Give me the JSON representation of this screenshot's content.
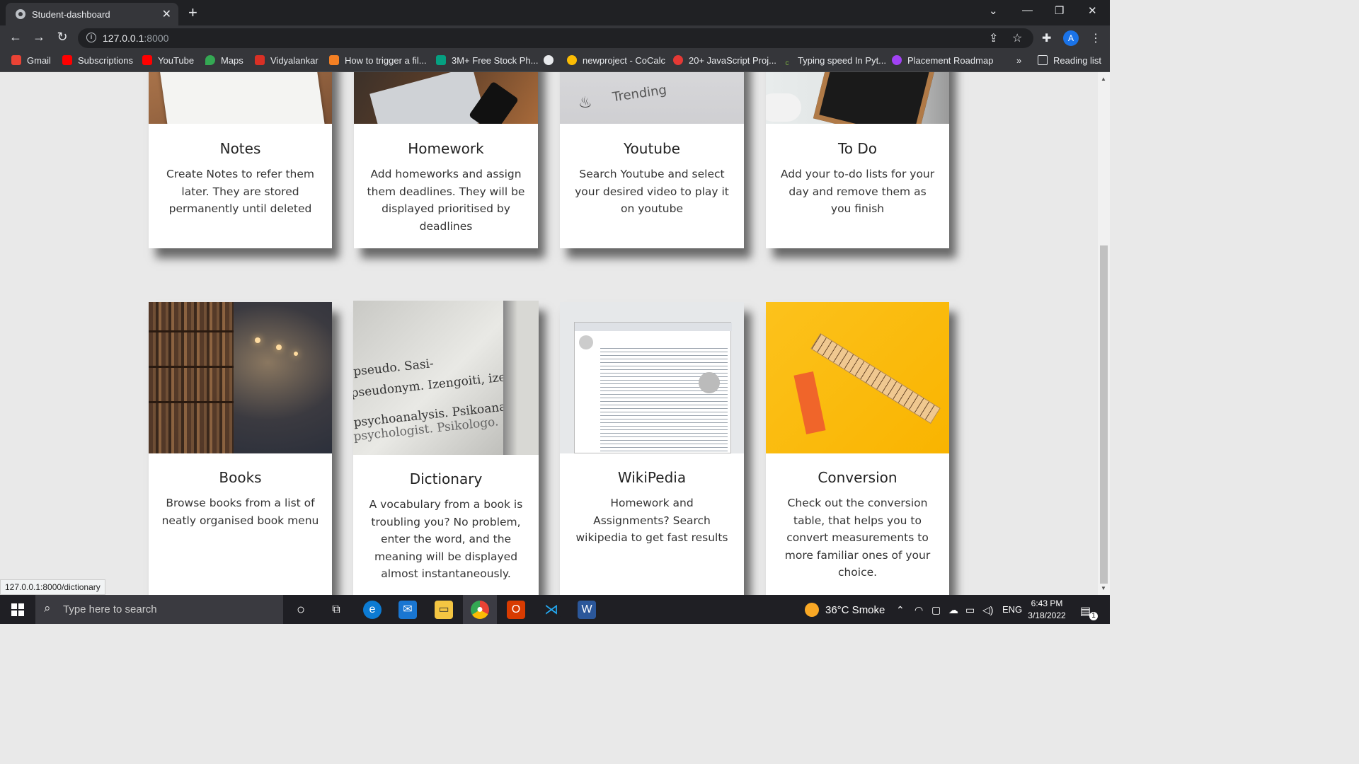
{
  "browser": {
    "tab_title": "Student-dashboard",
    "url_host": "127.0.0.1",
    "url_port": ":8000",
    "profile_initial": "A",
    "bookmarks": [
      "Gmail",
      "Subscriptions",
      "YouTube",
      "Maps",
      "Vidyalankar",
      "How to trigger a fil...",
      "3M+ Free Stock Ph...",
      "newproject - CoCalc",
      "20+ JavaScript Proj...",
      "Typing speed In Pyt...",
      "Placement Roadmap"
    ],
    "overflow": "»",
    "reading_list": "Reading list"
  },
  "cards_top": [
    {
      "title": "Notes",
      "desc": "Create Notes to refer them later. They are stored permanently until deleted"
    },
    {
      "title": "Homework",
      "desc": "Add homeworks and assign them deadlines. They will be displayed prioritised by deadlines"
    },
    {
      "title": "Youtube",
      "desc": "Search Youtube and select your desired video to play it on youtube",
      "image_text": "Trending"
    },
    {
      "title": "To Do",
      "desc": "Add your to-do lists for your day and remove them as you finish"
    }
  ],
  "cards_bottom": [
    {
      "title": "Books",
      "desc": "Browse books from a list of neatly organised book menu"
    },
    {
      "title": "Dictionary",
      "desc": "A vocabulary from a book is troubling you? No problem, enter the word, and the meaning will be displayed almost instantaneously."
    },
    {
      "title": "WikiPedia",
      "desc": "Homework and Assignments? Search wikipedia to get fast results"
    },
    {
      "title": "Conversion",
      "desc": "Check out the conversion table, that helps you to convert measurements to more familiar ones of your choice."
    }
  ],
  "dictionary_image_words": [
    "pseudo. Sasi-",
    "pseudonym. Izengoiti, izenor-",
    "psychoanalysis. Psikoanalisi.",
    "psychologist. Psikologo."
  ],
  "status_url": "127.0.0.1:8000/dictionary",
  "taskbar": {
    "search_placeholder": "Type here to search",
    "weather": "36°C  Smoke",
    "language": "ENG",
    "time": "6:43 PM",
    "date": "3/18/2022",
    "notification_count": "1"
  },
  "colors": {
    "chrome_dark": "#202124",
    "chrome_mid": "#35363a",
    "page_bg": "#e9e9e9",
    "conversion_yellow": "#fbbd0b"
  }
}
